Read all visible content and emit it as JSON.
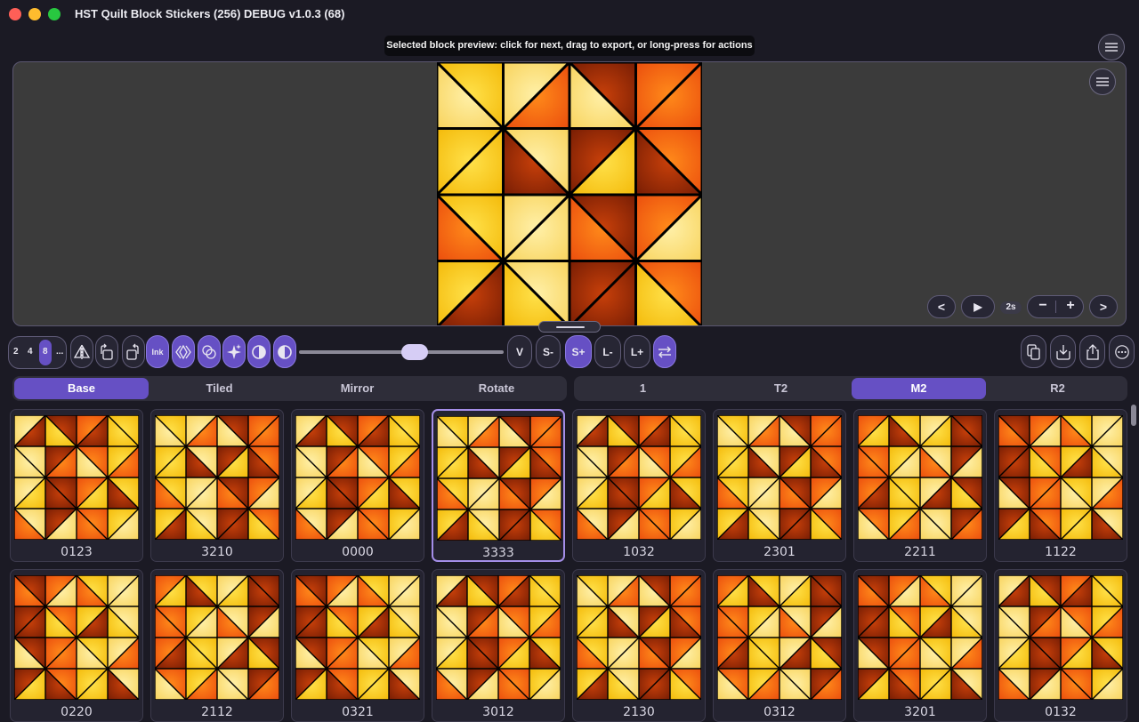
{
  "window": {
    "title": "HST Quilt Block Stickers (256) DEBUG v1.0.3 (68)"
  },
  "tooltip": "Selected block preview: click for next, drag to export, or long-press for actions",
  "preview_controls": {
    "prev": "<",
    "play": "▶",
    "interval": "2s",
    "zoom_out": "−",
    "zoom_in": "+",
    "next": ">"
  },
  "toolbar": {
    "sizes": [
      "2",
      "4",
      "8",
      "..."
    ],
    "selected_size": "8",
    "ink_label": "Ink",
    "v_label": "V",
    "s_minus": "S-",
    "s_plus": "S+",
    "l_minus": "L-",
    "l_plus": "L+",
    "slider_value": 0.56
  },
  "mode_tabs": [
    {
      "label": "Base",
      "selected": true
    },
    {
      "label": "Tiled",
      "selected": false
    },
    {
      "label": "Mirror",
      "selected": false
    },
    {
      "label": "Rotate",
      "selected": false
    }
  ],
  "variant_tabs": [
    {
      "label": "1",
      "selected": false
    },
    {
      "label": "T2",
      "selected": false
    },
    {
      "label": "M2",
      "selected": true
    },
    {
      "label": "R2",
      "selected": false
    }
  ],
  "blocks_row1": [
    "0123",
    "3210",
    "0000",
    "3333",
    "1032",
    "2301",
    "2211",
    "1122"
  ],
  "blocks_row2": [
    "0220",
    "2112",
    "0321",
    "3012",
    "2130",
    "0312",
    "3201",
    "0132"
  ],
  "selected_block": "3333",
  "colors": {
    "accent": "#6650c4",
    "accent_border": "#a48ee8",
    "orange": "#e8590c",
    "yellow": "#ffd500",
    "cream": "#fde58a",
    "dark_red": "#7a1d04"
  }
}
